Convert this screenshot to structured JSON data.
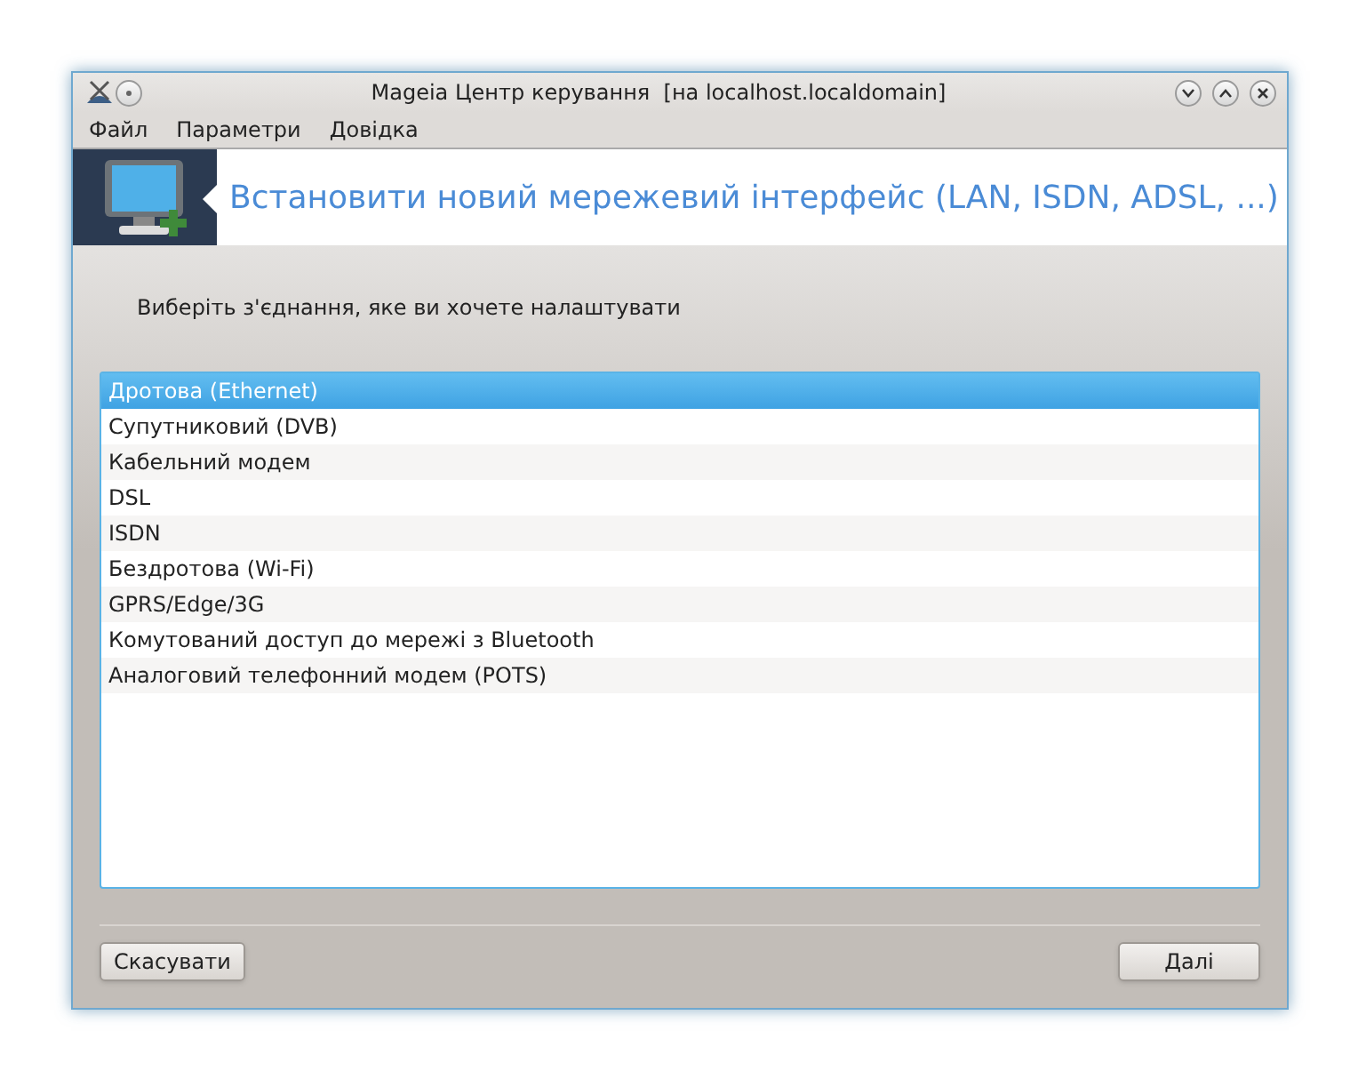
{
  "window": {
    "title": "Mageia Центр керування  [на localhost.localdomain]"
  },
  "menu": [
    "Файл",
    "Параметри",
    "Довідка"
  ],
  "header": {
    "title": "Встановити новий мережевий інтерфейс (LAN, ISDN, ADSL, ...)"
  },
  "prompt": "Виберіть з'єднання, яке ви хочете налаштувати",
  "connections": [
    {
      "label": "Дротова (Ethernet)",
      "selected": true
    },
    {
      "label": "Супутниковий (DVB)",
      "selected": false
    },
    {
      "label": "Кабельний модем",
      "selected": false
    },
    {
      "label": "DSL",
      "selected": false
    },
    {
      "label": "ISDN",
      "selected": false
    },
    {
      "label": "Бездротова (Wi-Fi)",
      "selected": false
    },
    {
      "label": "GPRS/Edge/3G",
      "selected": false
    },
    {
      "label": "Комутований доступ до мережі з Bluetooth",
      "selected": false
    },
    {
      "label": "Аналоговий телефонний модем (POTS)",
      "selected": false
    }
  ],
  "buttons": {
    "cancel": "Скасувати",
    "next": "Далі"
  }
}
